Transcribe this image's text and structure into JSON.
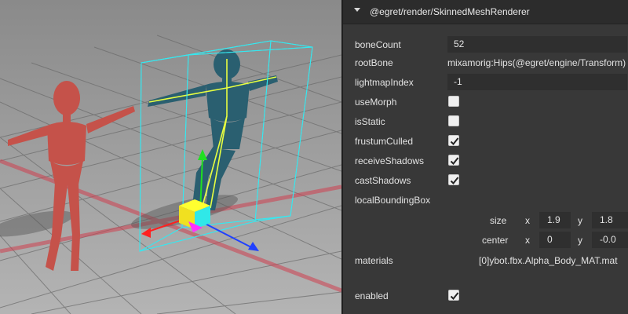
{
  "component": {
    "title": "@egret/render/SkinnedMeshRenderer"
  },
  "properties": {
    "boneCount": {
      "label": "boneCount",
      "value": "52"
    },
    "rootBone": {
      "label": "rootBone",
      "value": "mixamorig:Hips(@egret/engine/Transform)"
    },
    "lightmapIndex": {
      "label": "lightmapIndex",
      "value": "-1"
    },
    "useMorph": {
      "label": "useMorph",
      "checked": false
    },
    "isStatic": {
      "label": "isStatic",
      "checked": false
    },
    "frustumCulled": {
      "label": "frustumCulled",
      "checked": true
    },
    "receiveShadows": {
      "label": "receiveShadows",
      "checked": true
    },
    "castShadows": {
      "label": "castShadows",
      "checked": true
    },
    "localBoundingBox": {
      "label": "localBoundingBox",
      "size": {
        "label": "size",
        "x_label": "x",
        "x": "1.9",
        "y_label": "y",
        "y": "1.8"
      },
      "center": {
        "label": "center",
        "x_label": "x",
        "x": "0",
        "y_label": "y",
        "y": "-0.0"
      }
    },
    "materials": {
      "label": "materials",
      "value": "[0]ybot.fbx.Alpha_Body_MAT.mat"
    },
    "enabled": {
      "label": "enabled",
      "checked": true
    }
  },
  "colors": {
    "panel_bg": "#383838",
    "header_bg": "#2c2c2c",
    "field_bg": "#2f2f2f",
    "checkbox_bg": "#f0f0f0",
    "selection_box": "#35e8f0",
    "gizmo_x": "#ff2020",
    "gizmo_y": "#20e020",
    "gizmo_z": "#2040ff",
    "figure_left": "#c5524a",
    "figure_right": "#2a5f70",
    "ground_line": "#d04050"
  },
  "icons": {
    "collapse": "triangle-down-icon",
    "check": "checkmark-icon"
  }
}
